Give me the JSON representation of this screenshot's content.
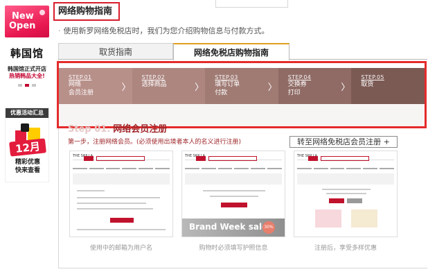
{
  "sidebar": {
    "new_open": {
      "line1": "New",
      "line2": "Open"
    },
    "korea_hall": {
      "title": "韩国馆",
      "line1": "韩国馆正式开店",
      "line2": "热销韩品大全!"
    },
    "event": {
      "header": "优惠活动汇总",
      "month": "12月",
      "line1": "精彩优惠",
      "line2": "快来查看"
    }
  },
  "header": {
    "title": "网络购物指南",
    "bullet": "·",
    "subtitle": "使用新罗网络免税店时，我们为您介绍购物信息与付款方式。"
  },
  "tabs": [
    {
      "label": "取货指南",
      "active": false
    },
    {
      "label": "网络免税店购物指南",
      "active": true
    }
  ],
  "steps": [
    {
      "num": "STEP.01",
      "label_line1": "网络",
      "label_line2": "会员注册"
    },
    {
      "num": "STEP.02",
      "label_line1": "选择商品",
      "label_line2": ""
    },
    {
      "num": "STEP.03",
      "label_line1": "填写订单",
      "label_line2": "付款"
    },
    {
      "num": "STEP.04",
      "label_line1": "交换券",
      "label_line2": "打印"
    },
    {
      "num": "STEP.05",
      "label_line1": "取货",
      "label_line2": ""
    }
  ],
  "step_arrow": "〉",
  "section": {
    "prefix": "Step 01.",
    "title": "网络会员注册",
    "first_step": "第一步，注册网络会员。(必须使用出境者本人的名义进行注册)",
    "goto_button": "转至网络免税店会员注册 +"
  },
  "thumbnails": [
    {
      "caption": "使用中的邮箱为用户名",
      "logo": "THE SHILLA"
    },
    {
      "caption": "购物时必须填写护照信息",
      "logo": "THE SHILLA",
      "banner": "Brand Week sale",
      "sale": "30%"
    },
    {
      "caption": "注册后，享受多样优惠",
      "logo": "THE SHILLA"
    }
  ],
  "colors": {
    "accent_red": "#d81e2c",
    "step_title": "#a0282c",
    "tab_active_top": "#e0a020"
  }
}
